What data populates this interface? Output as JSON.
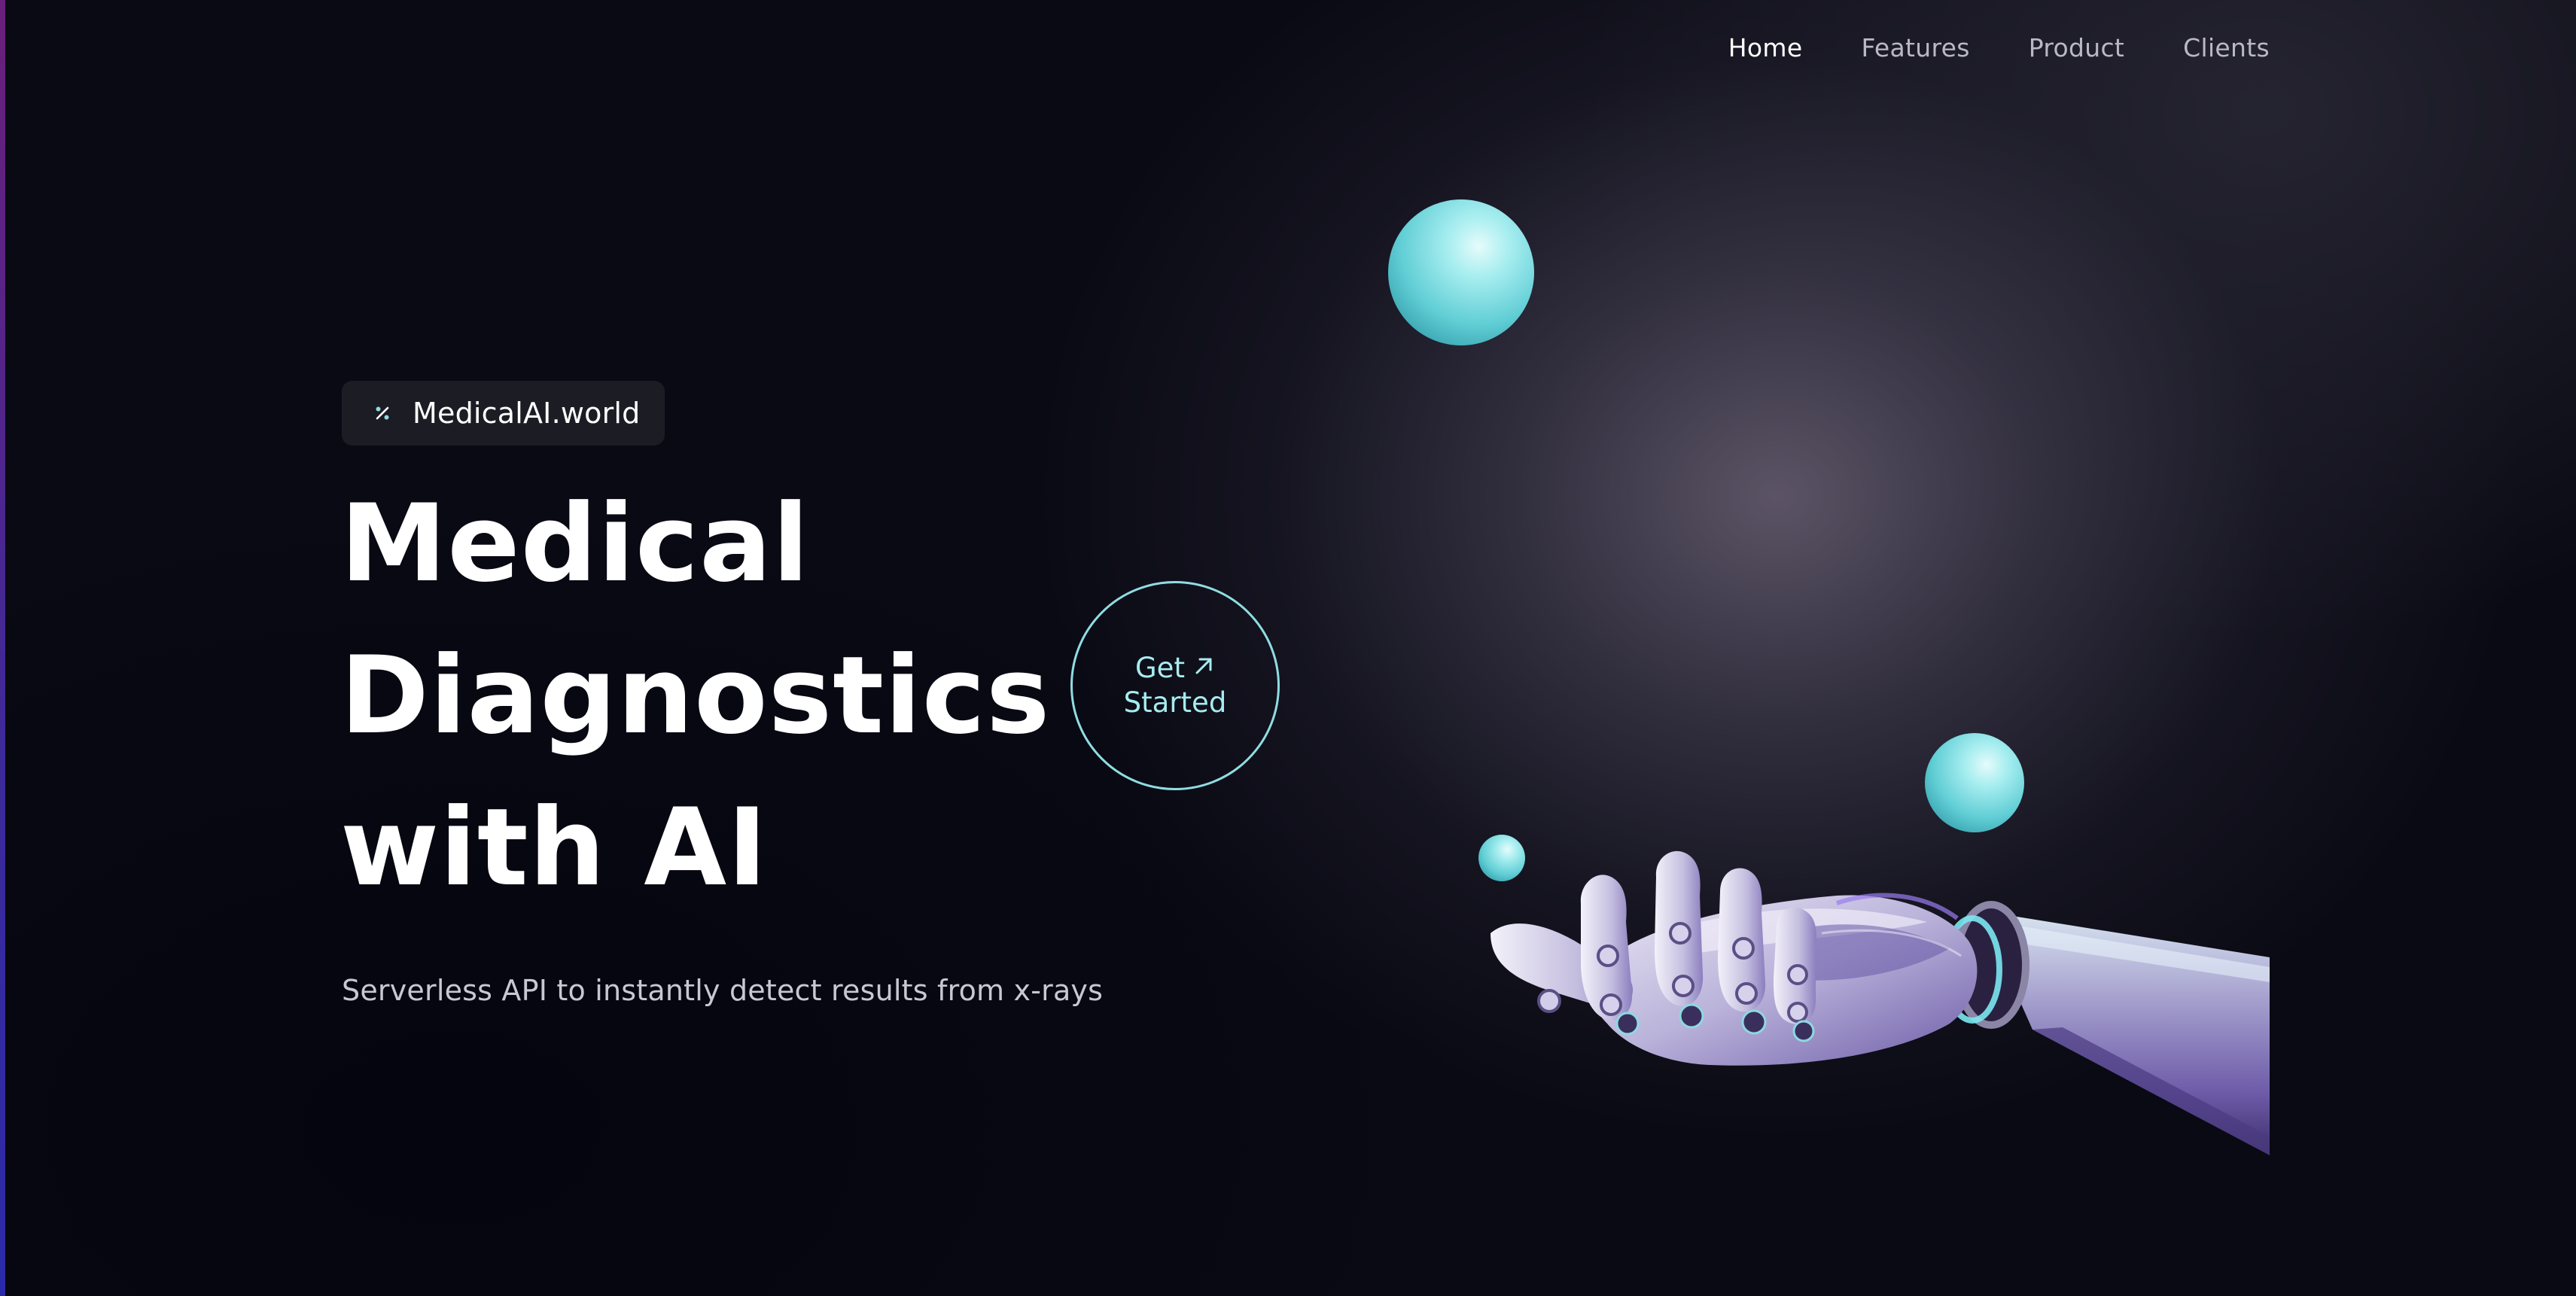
{
  "nav": {
    "items": [
      {
        "label": "Home",
        "active": true
      },
      {
        "label": "Features",
        "active": false
      },
      {
        "label": "Product",
        "active": false
      },
      {
        "label": "Clients",
        "active": false
      }
    ]
  },
  "badge": {
    "icon": "percent-icon",
    "label": "MedicalAI.world"
  },
  "hero": {
    "headline_lines": [
      "Medical",
      "Diagnostics",
      "with AI"
    ],
    "subtitle": "Serverless API to instantly detect results from x-rays"
  },
  "cta": {
    "line1": "Get",
    "line2": "Started",
    "icon": "arrow-up-right-icon"
  },
  "illustration": {
    "icon": "robot-hand-with-spheres"
  },
  "colors": {
    "background": "#0a0a14",
    "accent": "#8fdde2",
    "text": "#ffffff",
    "muted": "#b9b8c4"
  }
}
